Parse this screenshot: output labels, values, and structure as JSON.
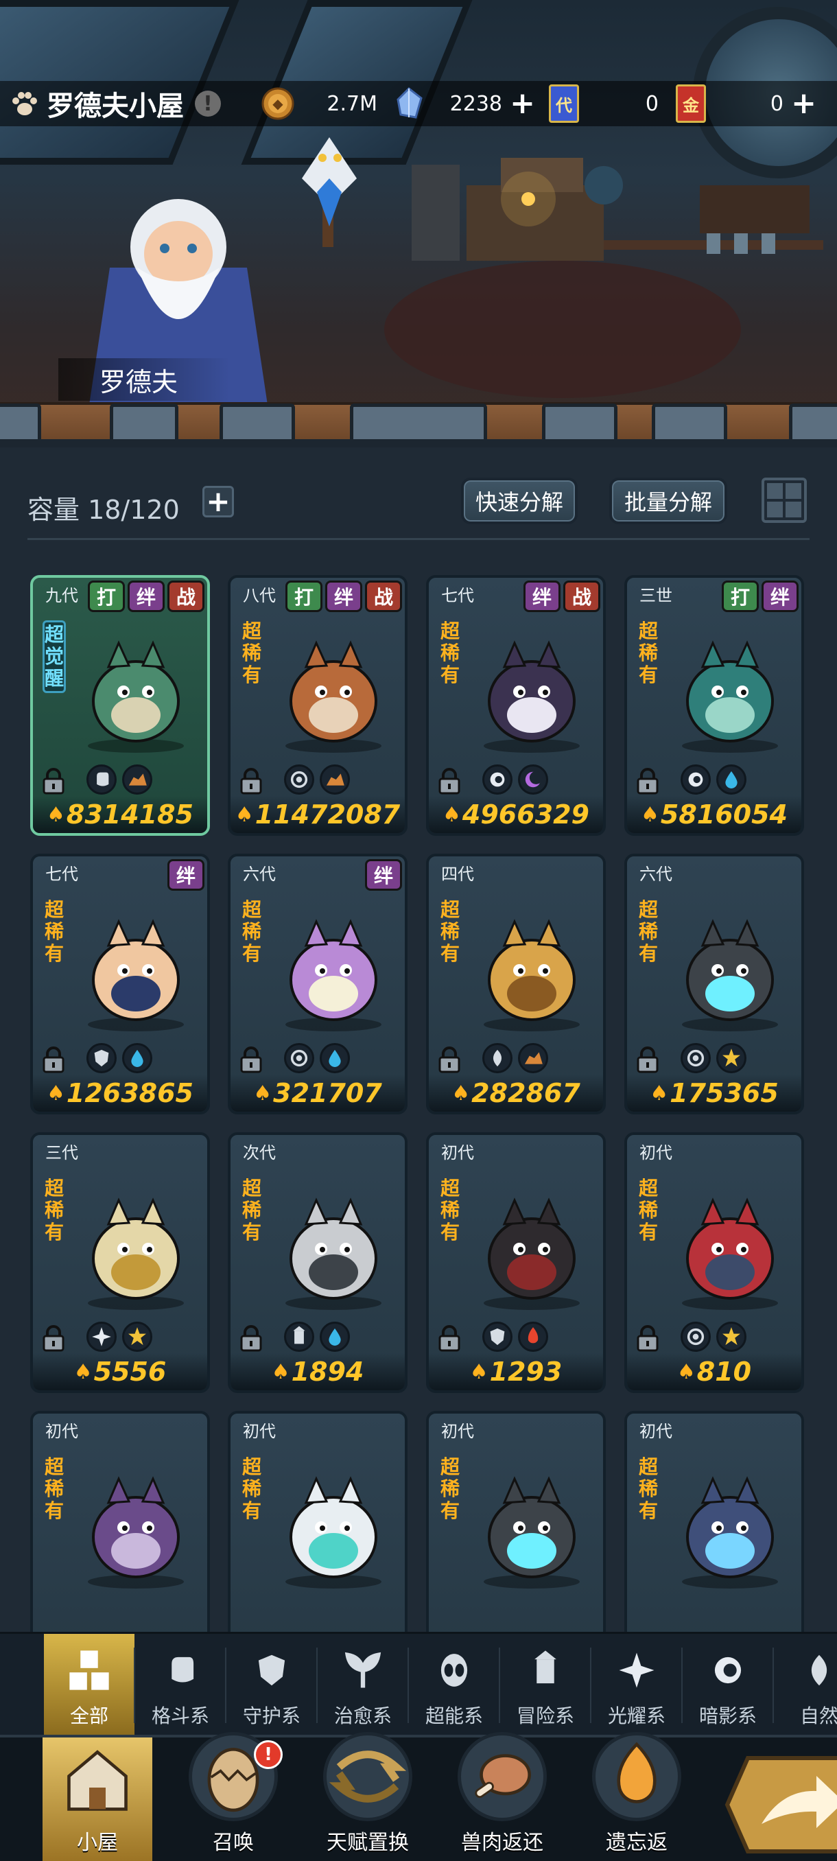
{
  "location": {
    "title": "罗德夫小屋",
    "info_glyph": "!"
  },
  "resources": {
    "coins": "2.7M",
    "diamonds": "2238",
    "tickets_a": "0",
    "tickets_b": "0",
    "ticket_a_glyph": "代",
    "ticket_b_glyph": "金"
  },
  "npc": {
    "name": "罗德夫"
  },
  "capacity": {
    "label": "容量 18/120",
    "plus": "+"
  },
  "buttons": {
    "quick_decompose": "快速分解",
    "batch_decompose": "批量分解"
  },
  "rarity": {
    "super_rare": "超稀有",
    "super_awaken": "超觉醒"
  },
  "tag_labels": {
    "fight": "打",
    "bond": "绊",
    "battle": "战"
  },
  "cards": [
    {
      "gen": "九代",
      "tags": [
        "打",
        "绊",
        "战"
      ],
      "rarity": "超觉醒",
      "power": "8314185",
      "icons": [
        "fist-icon",
        "earth-icon"
      ],
      "monster": "wizard-mushroom"
    },
    {
      "gen": "八代",
      "tags": [
        "打",
        "绊",
        "战"
      ],
      "rarity": "超稀有",
      "power": "11472087",
      "icons": [
        "ring-icon",
        "earth-icon"
      ],
      "monster": "crab-beast"
    },
    {
      "gen": "七代",
      "tags": [
        "绊",
        "战"
      ],
      "rarity": "超稀有",
      "power": "4966329",
      "icons": [
        "eye-icon",
        "moon-icon"
      ],
      "monster": "shadow-fox"
    },
    {
      "gen": "三世",
      "tags": [
        "打",
        "绊"
      ],
      "rarity": "超稀有",
      "power": "5816054",
      "icons": [
        "eye-icon",
        "water-icon"
      ],
      "monster": "sea-dragon"
    },
    {
      "gen": "七代",
      "tags": [
        "绊"
      ],
      "rarity": "超稀有",
      "power": "1263865",
      "icons": [
        "shield-icon",
        "water-icon"
      ],
      "monster": "bunny-mage"
    },
    {
      "gen": "六代",
      "tags": [
        "绊"
      ],
      "rarity": "超稀有",
      "power": "321707",
      "icons": [
        "ring-icon",
        "water-icon"
      ],
      "monster": "dj-frog"
    },
    {
      "gen": "四代",
      "tags": [],
      "rarity": "超稀有",
      "power": "282867",
      "icons": [
        "leaf-icon",
        "earth-icon"
      ],
      "monster": "spiky-platypus"
    },
    {
      "gen": "六代",
      "tags": [],
      "rarity": "超稀有",
      "power": "175365",
      "icons": [
        "ring-icon",
        "sun-icon"
      ],
      "monster": "stone-crab"
    },
    {
      "gen": "三代",
      "tags": [],
      "rarity": "超稀有",
      "power": "5556",
      "icons": [
        "star-icon",
        "sun-icon"
      ],
      "monster": "gold-dragon"
    },
    {
      "gen": "次代",
      "tags": [],
      "rarity": "超稀有",
      "power": "1894",
      "icons": [
        "tower-icon",
        "water-icon"
      ],
      "monster": "grey-dragon"
    },
    {
      "gen": "初代",
      "tags": [],
      "rarity": "超稀有",
      "power": "1293",
      "icons": [
        "shield-icon",
        "fire-icon"
      ],
      "monster": "dark-boar"
    },
    {
      "gen": "初代",
      "tags": [],
      "rarity": "超稀有",
      "power": "810",
      "icons": [
        "ring-icon",
        "sun-icon"
      ],
      "monster": "red-serpent"
    },
    {
      "gen": "初代",
      "tags": [],
      "rarity": "超稀有",
      "power": "",
      "icons": [],
      "monster": "purple-dragon"
    },
    {
      "gen": "初代",
      "tags": [],
      "rarity": "超稀有",
      "power": "",
      "icons": [],
      "monster": "antler-deer"
    },
    {
      "gen": "初代",
      "tags": [],
      "rarity": "超稀有",
      "power": "",
      "icons": [],
      "monster": "stone-crab"
    },
    {
      "gen": "初代",
      "tags": [],
      "rarity": "超稀有",
      "power": "",
      "icons": [],
      "monster": "ice-shark"
    }
  ],
  "categories": [
    {
      "label": "全部",
      "icon": "blocks-icon",
      "active": true
    },
    {
      "label": "格斗系",
      "icon": "fist-icon"
    },
    {
      "label": "守护系",
      "icon": "shield-icon"
    },
    {
      "label": "治愈系",
      "icon": "sprout-icon"
    },
    {
      "label": "超能系",
      "icon": "alien-icon"
    },
    {
      "label": "冒险系",
      "icon": "tower-icon"
    },
    {
      "label": "光耀系",
      "icon": "star-icon"
    },
    {
      "label": "暗影系",
      "icon": "eye-icon"
    },
    {
      "label": "自然",
      "icon": "leaf-icon"
    }
  ],
  "nav": [
    {
      "label": "小屋",
      "icon": "house-icon",
      "active": true
    },
    {
      "label": "召唤",
      "icon": "egg-icon",
      "badge": "!"
    },
    {
      "label": "天赋置换",
      "icon": "swap-icon"
    },
    {
      "label": "兽肉返还",
      "icon": "meat-icon"
    },
    {
      "label": "遗忘返",
      "icon": "flame-icon"
    }
  ],
  "colors": {
    "accent": "#ffc629",
    "rarity": "#ffb21e",
    "panel": "#1f2a35",
    "active_tab": "#d8b64a"
  }
}
